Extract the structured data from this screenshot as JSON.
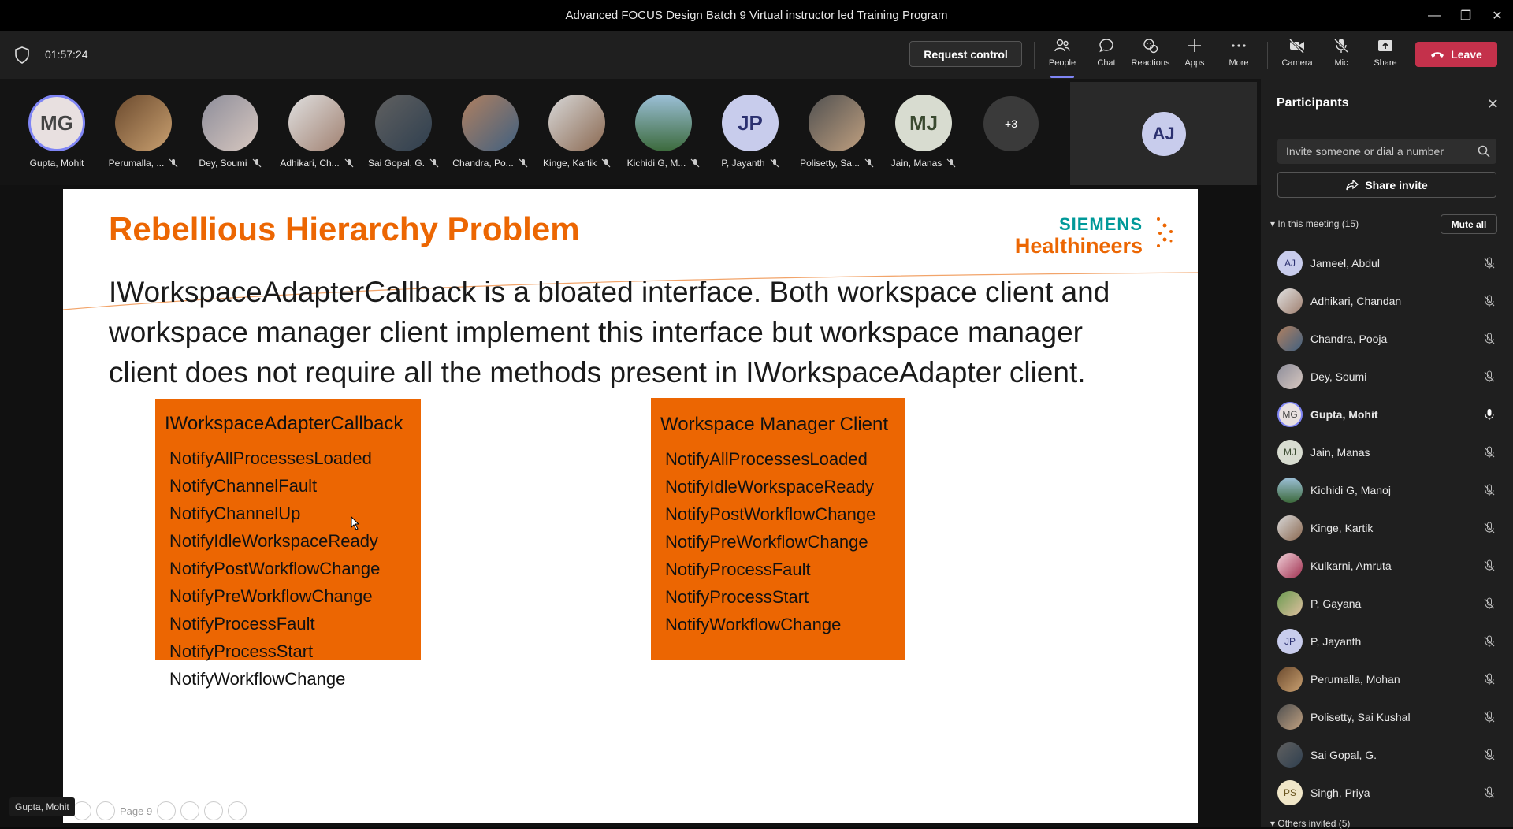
{
  "window": {
    "title": "Advanced FOCUS Design Batch 9 Virtual instructor led Training Program"
  },
  "toolbar": {
    "timer": "01:57:24",
    "request_control": "Request control",
    "people": "People",
    "chat": "Chat",
    "reactions": "Reactions",
    "apps": "Apps",
    "more": "More",
    "camera": "Camera",
    "mic": "Mic",
    "share": "Share",
    "leave": "Leave"
  },
  "strip": {
    "attendees": [
      {
        "initials": "MG",
        "name": "Gupta, Mohit"
      },
      {
        "initials": "",
        "name": "Perumalla, ..."
      },
      {
        "initials": "",
        "name": "Dey, Soumi"
      },
      {
        "initials": "",
        "name": "Adhikari, Ch..."
      },
      {
        "initials": "",
        "name": "Sai Gopal, G."
      },
      {
        "initials": "",
        "name": "Chandra, Po..."
      },
      {
        "initials": "",
        "name": "Kinge, Kartik"
      },
      {
        "initials": "",
        "name": "Kichidi G, M..."
      },
      {
        "initials": "JP",
        "name": "P, Jayanth"
      },
      {
        "initials": "",
        "name": "Polisetty, Sa..."
      },
      {
        "initials": "MJ",
        "name": "Jain, Manas"
      }
    ],
    "overflow": "+3",
    "self_initials": "AJ"
  },
  "slide": {
    "title": "Rebellious Hierarchy Problem",
    "logo_line1": "SIEMENS",
    "logo_line2": "Healthineers",
    "paragraph": "IWorkspaceAdapterCallback is a bloated interface. Both workspace client and workspace manager client implement this interface but workspace manager client does not require all the methods present in IWorkspaceAdapter client.",
    "box1": {
      "title": "IWorkspaceAdapterCallback",
      "items": [
        "NotifyAllProcessesLoaded",
        "NotifyChannelFault",
        "NotifyChannelUp",
        "NotifyIdleWorkspaceReady",
        "NotifyPostWorkflowChange",
        "NotifyPreWorkflowChange",
        "NotifyProcessFault",
        "NotifyProcessStart",
        "NotifyWorkflowChange"
      ]
    },
    "box2": {
      "title": "Workspace Manager Client",
      "items": [
        "NotifyAllProcessesLoaded",
        "NotifyIdleWorkspaceReady",
        "NotifyPostWorkflowChange",
        "NotifyPreWorkflowChange",
        "NotifyProcessFault",
        "NotifyProcessStart",
        "NotifyWorkflowChange"
      ]
    },
    "page": "Page 9",
    "presenter": "Gupta, Mohit"
  },
  "panel": {
    "title": "Participants",
    "invite_placeholder": "Invite someone or dial a number",
    "share_invite": "Share invite",
    "in_meeting": "In this meeting (15)",
    "mute_all": "Mute all",
    "others_invited": "Others invited (5)",
    "participants": [
      {
        "initials": "AJ",
        "name": "Jameel, Abdul",
        "speaking": false
      },
      {
        "initials": "",
        "name": "Adhikari, Chandan",
        "speaking": false
      },
      {
        "initials": "",
        "name": "Chandra, Pooja",
        "speaking": false
      },
      {
        "initials": "",
        "name": "Dey, Soumi",
        "speaking": false
      },
      {
        "initials": "MG",
        "name": "Gupta, Mohit",
        "speaking": true
      },
      {
        "initials": "MJ",
        "name": "Jain, Manas",
        "speaking": false
      },
      {
        "initials": "",
        "name": "Kichidi G, Manoj",
        "speaking": false
      },
      {
        "initials": "",
        "name": "Kinge, Kartik",
        "speaking": false
      },
      {
        "initials": "",
        "name": "Kulkarni, Amruta",
        "speaking": false
      },
      {
        "initials": "",
        "name": "P, Gayana",
        "speaking": false
      },
      {
        "initials": "JP",
        "name": "P, Jayanth",
        "speaking": false
      },
      {
        "initials": "",
        "name": "Perumalla, Mohan",
        "speaking": false
      },
      {
        "initials": "",
        "name": "Polisetty, Sai Kushal",
        "speaking": false
      },
      {
        "initials": "",
        "name": "Sai Gopal, G.",
        "speaking": false
      },
      {
        "initials": "PS",
        "name": "Singh, Priya",
        "speaking": false
      }
    ]
  },
  "colors": {
    "accent": "#ec6602",
    "teal": "#009999",
    "leave": "#c4314b",
    "teams_purple": "#7f85f5"
  }
}
